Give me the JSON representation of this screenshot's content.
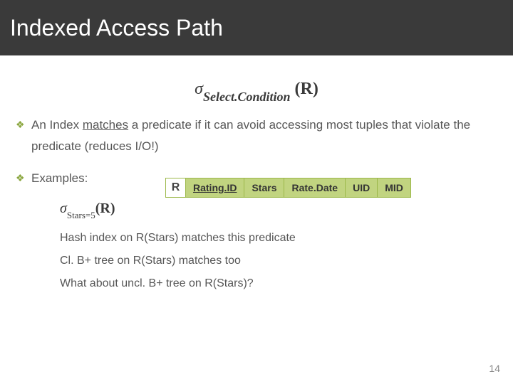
{
  "title": "Indexed Access Path",
  "formula": {
    "sigma": "σ",
    "subscript": "Select.Condition",
    "arg": "(R)"
  },
  "bullet1": {
    "pre": "An Index ",
    "matches": "matches",
    "post": " a predicate if it can avoid accessing most tuples that violate the predicate (reduces I/O!)"
  },
  "bullet2": {
    "label": "Examples:"
  },
  "schema": {
    "R": "R",
    "cols": [
      "Rating.ID",
      "Stars",
      "Rate.Date",
      "UID",
      "MID"
    ]
  },
  "subformula": {
    "sigma": "σ",
    "subscript": "Stars=5",
    "arg": "(R)"
  },
  "lines": {
    "l1": "Hash index on R(Stars) matches this predicate",
    "l2": "Cl. B+ tree on R(Stars) matches too",
    "l3": "What about uncl. B+ tree on R(Stars)?"
  },
  "page": "14"
}
